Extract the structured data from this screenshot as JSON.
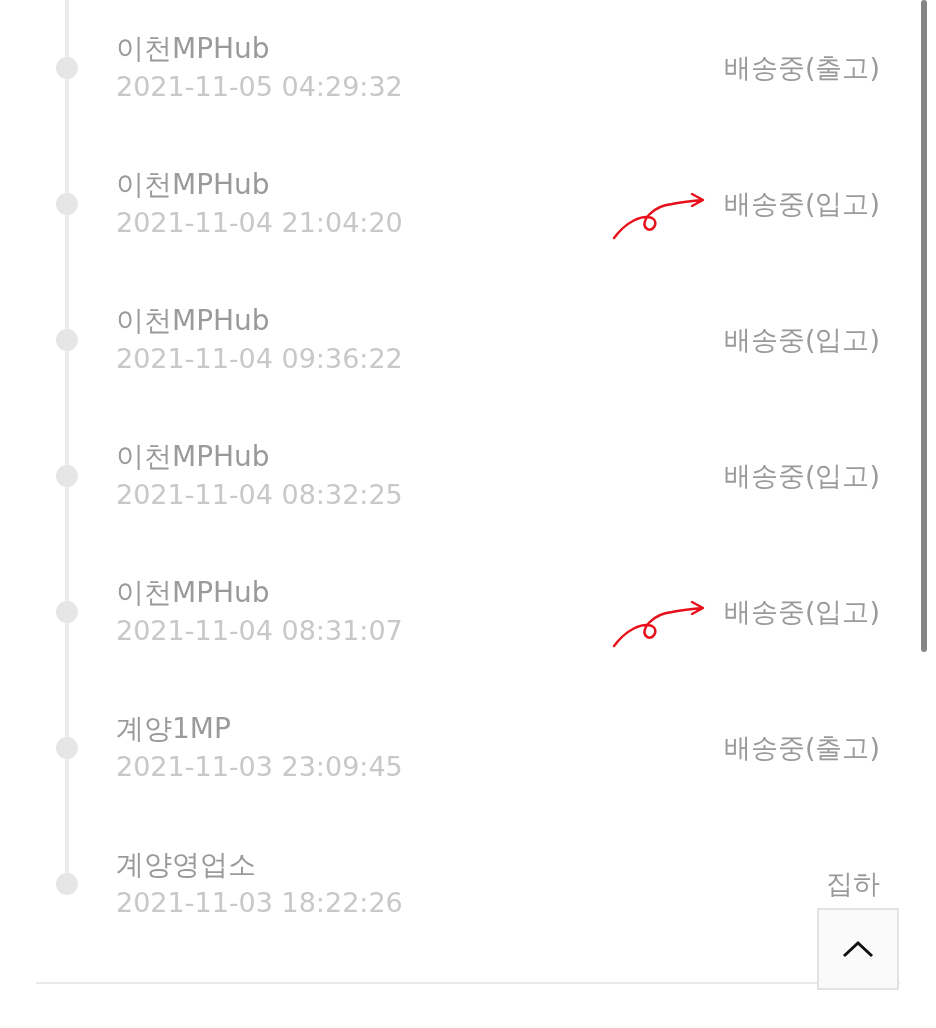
{
  "tracking": [
    {
      "location": "이천MPHub",
      "time": "2021-11-05 04:29:32",
      "status": "배송중(출고)",
      "marked": false
    },
    {
      "location": "이천MPHub",
      "time": "2021-11-04 21:04:20",
      "status": "배송중(입고)",
      "marked": true
    },
    {
      "location": "이천MPHub",
      "time": "2021-11-04 09:36:22",
      "status": "배송중(입고)",
      "marked": false
    },
    {
      "location": "이천MPHub",
      "time": "2021-11-04 08:32:25",
      "status": "배송중(입고)",
      "marked": false
    },
    {
      "location": "이천MPHub",
      "time": "2021-11-04 08:31:07",
      "status": "배송중(입고)",
      "marked": true
    },
    {
      "location": "계양1MP",
      "time": "2021-11-03 23:09:45",
      "status": "배송중(출고)",
      "marked": false
    },
    {
      "location": "계양영업소",
      "time": "2021-11-03 18:22:26",
      "status": "집하",
      "marked": false
    }
  ]
}
